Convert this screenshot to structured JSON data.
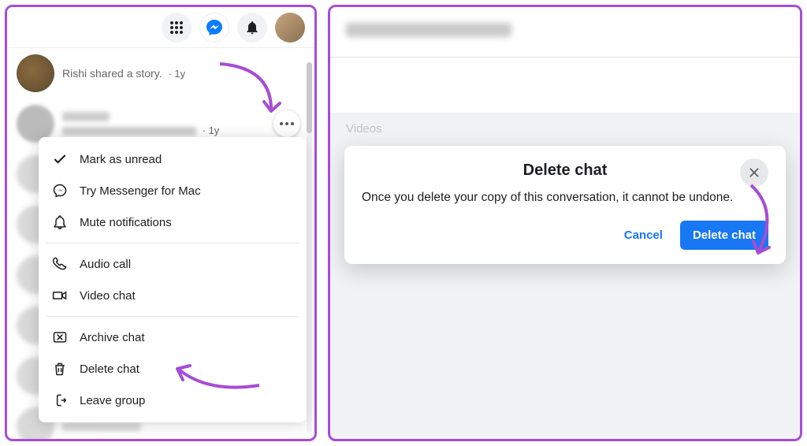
{
  "topbar": {
    "apps_icon": "apps",
    "messenger_icon": "messenger",
    "bell_icon": "notifications"
  },
  "chats": {
    "first": {
      "text": "Rishi shared a story.",
      "time": "1y"
    },
    "second": {
      "time": "1y"
    }
  },
  "menu": {
    "mark_unread": "Mark as unread",
    "try_messenger": "Try Messenger for Mac",
    "mute": "Mute notifications",
    "audio_call": "Audio call",
    "video_chat": "Video chat",
    "archive": "Archive chat",
    "delete": "Delete chat",
    "leave": "Leave group"
  },
  "right": {
    "tab_videos": "Videos"
  },
  "modal": {
    "title": "Delete chat",
    "body": "Once you delete your copy of this conversation, it cannot be undone.",
    "cancel": "Cancel",
    "confirm": "Delete chat"
  },
  "colors": {
    "accent": "#1877f2",
    "annotation": "#a74cd6"
  }
}
